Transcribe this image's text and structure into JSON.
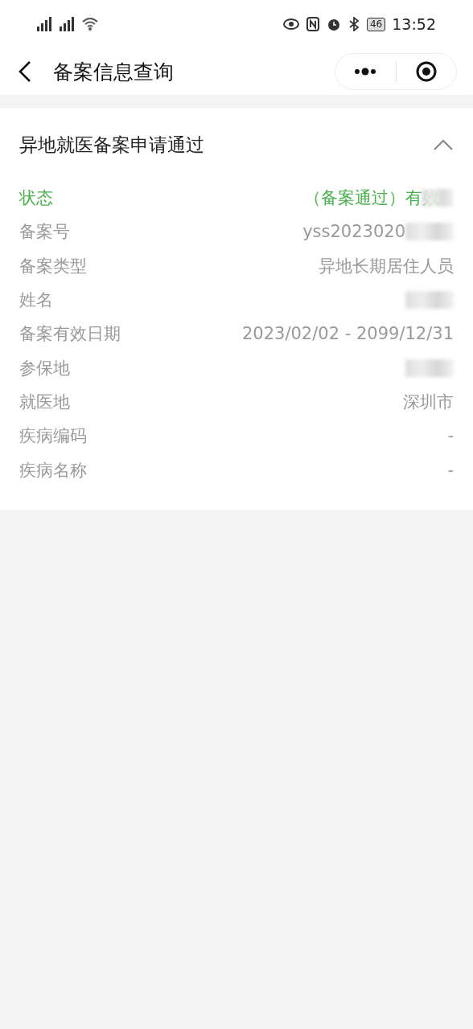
{
  "status_bar": {
    "time": "13:52",
    "battery": "46"
  },
  "nav": {
    "title": "备案信息查询"
  },
  "card": {
    "title": "异地就医备案申请通过",
    "expanded": true,
    "rows": [
      {
        "kind": "status",
        "label": "状态",
        "value": "（备案通过）有效",
        "redacted": true
      },
      {
        "kind": "text",
        "label": "备案号",
        "value": "yss2023020",
        "redacted": true
      },
      {
        "kind": "text",
        "label": "备案类型",
        "value": "异地长期居住人员"
      },
      {
        "kind": "text",
        "label": "姓名",
        "redacted": true
      },
      {
        "kind": "text",
        "label": "备案有效日期",
        "value": "2023/02/02 - 2099/12/31"
      },
      {
        "kind": "text",
        "label": "参保地",
        "redacted": true
      },
      {
        "kind": "text",
        "label": "就医地",
        "value": "深圳市"
      },
      {
        "kind": "text",
        "label": "疾病编码",
        "value": "-"
      },
      {
        "kind": "text",
        "label": "疾病名称",
        "value": "-"
      }
    ]
  }
}
